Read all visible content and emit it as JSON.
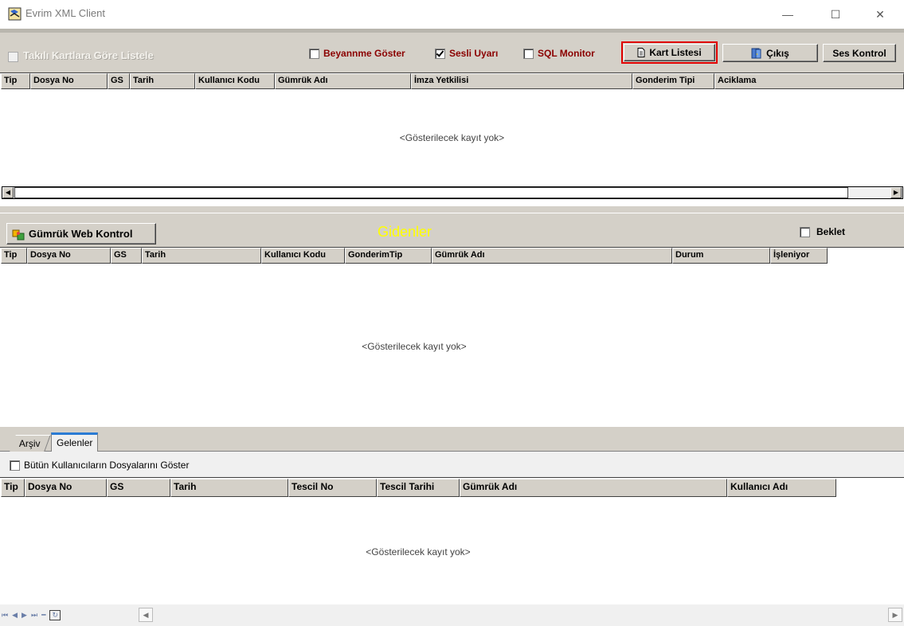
{
  "window": {
    "title": "Evrim XML Client",
    "controls": {
      "minimize": "—",
      "maximize": "☐",
      "close": "✕"
    }
  },
  "top_panel": {
    "takili_label": "Takılı Kartlara Göre Listele",
    "options": [
      {
        "label": "Beyannme Göster",
        "checked": false
      },
      {
        "label": "Sesli Uyarı",
        "checked": true
      },
      {
        "label": "SQL Monitor",
        "checked": false
      }
    ],
    "buttons": {
      "kart_listesi": "Kart Listesi",
      "cikis": "Çıkış",
      "ses_kontrol": "Ses Kontrol"
    },
    "columns": [
      "Tip",
      "Dosya No",
      "GS",
      "Tarih",
      "Kullanıcı Kodu",
      "Gümrük Adı",
      "İmza Yetkilisi",
      "Gonderim Tipi",
      "Aciklama"
    ],
    "empty_text": "<Gösterilecek kayıt yok>"
  },
  "middle_panel": {
    "web_button": "Gümrük Web Kontrol",
    "section_title": "Gidenler",
    "beklet_label": "Beklet",
    "columns": [
      "Tip",
      "Dosya No",
      "GS",
      "Tarih",
      "Kullanıcı Kodu",
      "GonderimTip",
      "Gümrük Adı",
      "Durum",
      "İşleniyor"
    ],
    "empty_text": "<Gösterilecek kayıt yok>"
  },
  "bottom_panel": {
    "tabs": [
      {
        "label": "Arşiv",
        "active": false
      },
      {
        "label": "Gelenler",
        "active": true
      }
    ],
    "all_users_label": "Bütün Kullanıcıların Dosyalarını Göster",
    "columns": [
      "Tip",
      "Dosya No",
      "GS",
      "Tarih",
      "Tescil No",
      "Tescil Tarihi",
      "Gümrük Adı",
      "Kullanıcı Adı"
    ],
    "empty_text": "<Gösterilecek kayıt yok>"
  },
  "colors": {
    "panel_gray": "#d4d0c8",
    "option_red": "#8b0000",
    "title_yellow": "#ffff00",
    "highlight_red": "#e00000"
  }
}
